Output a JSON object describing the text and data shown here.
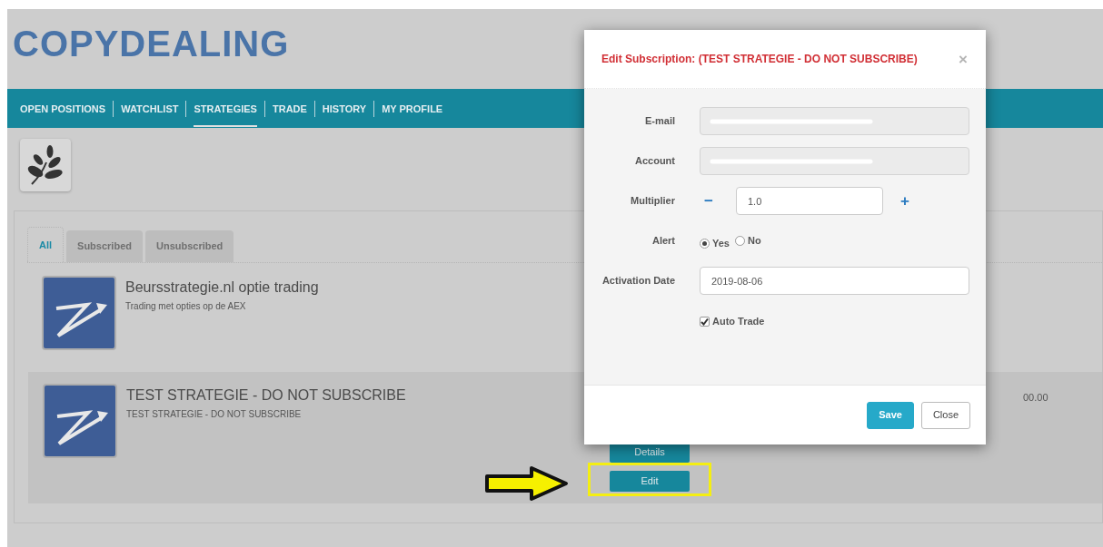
{
  "logo": {
    "text": "COPYDEALING"
  },
  "nav": [
    {
      "label": "OPEN POSITIONS",
      "selected": false
    },
    {
      "label": "WATCHLIST",
      "selected": false
    },
    {
      "label": "STRATEGIES",
      "selected": true
    },
    {
      "label": "TRADE",
      "selected": false
    },
    {
      "label": "HISTORY",
      "selected": false
    },
    {
      "label": "MY PROFILE",
      "selected": false
    }
  ],
  "tabs": [
    {
      "label": "All",
      "selected": true
    },
    {
      "label": "Subscribed",
      "selected": false
    },
    {
      "label": "Unsubscribed",
      "selected": false
    }
  ],
  "strategies": [
    {
      "name": "Beursstrategie.nl optie trading",
      "description": "Trading met opties op de AEX",
      "highlighted": false
    },
    {
      "name": "TEST STRATEGIE - DO NOT SUBSCRIBE",
      "description": "TEST STRATEGIE - DO NOT SUBSCRIBE",
      "highlighted": true,
      "amount": "00.00",
      "buttons": [
        {
          "label": "Details",
          "marked": false
        },
        {
          "label": "Edit",
          "marked": true
        }
      ]
    }
  ],
  "modal": {
    "title": "Edit Subscription: (TEST STRATEGIE - DO NOT SUBSCRIBE)",
    "close": "×",
    "fields": [
      {
        "kind": "redacted",
        "label": "E-mail"
      },
      {
        "kind": "redacted",
        "label": "Account"
      },
      {
        "kind": "stepper",
        "label": "Multiplier",
        "value": "1.0",
        "minus": "−",
        "plus": "+"
      },
      {
        "kind": "radio",
        "label": "Alert",
        "options": [
          {
            "label": "Yes",
            "selected": true
          },
          {
            "label": "No",
            "selected": false
          }
        ]
      },
      {
        "kind": "text",
        "label": "Activation Date",
        "value": "2019-08-06"
      },
      {
        "kind": "checkbox",
        "label": "Auto Trade",
        "checked": true
      }
    ],
    "buttons": [
      {
        "label": "Save",
        "kind": "primary"
      },
      {
        "label": "Close",
        "kind": "default"
      }
    ]
  }
}
